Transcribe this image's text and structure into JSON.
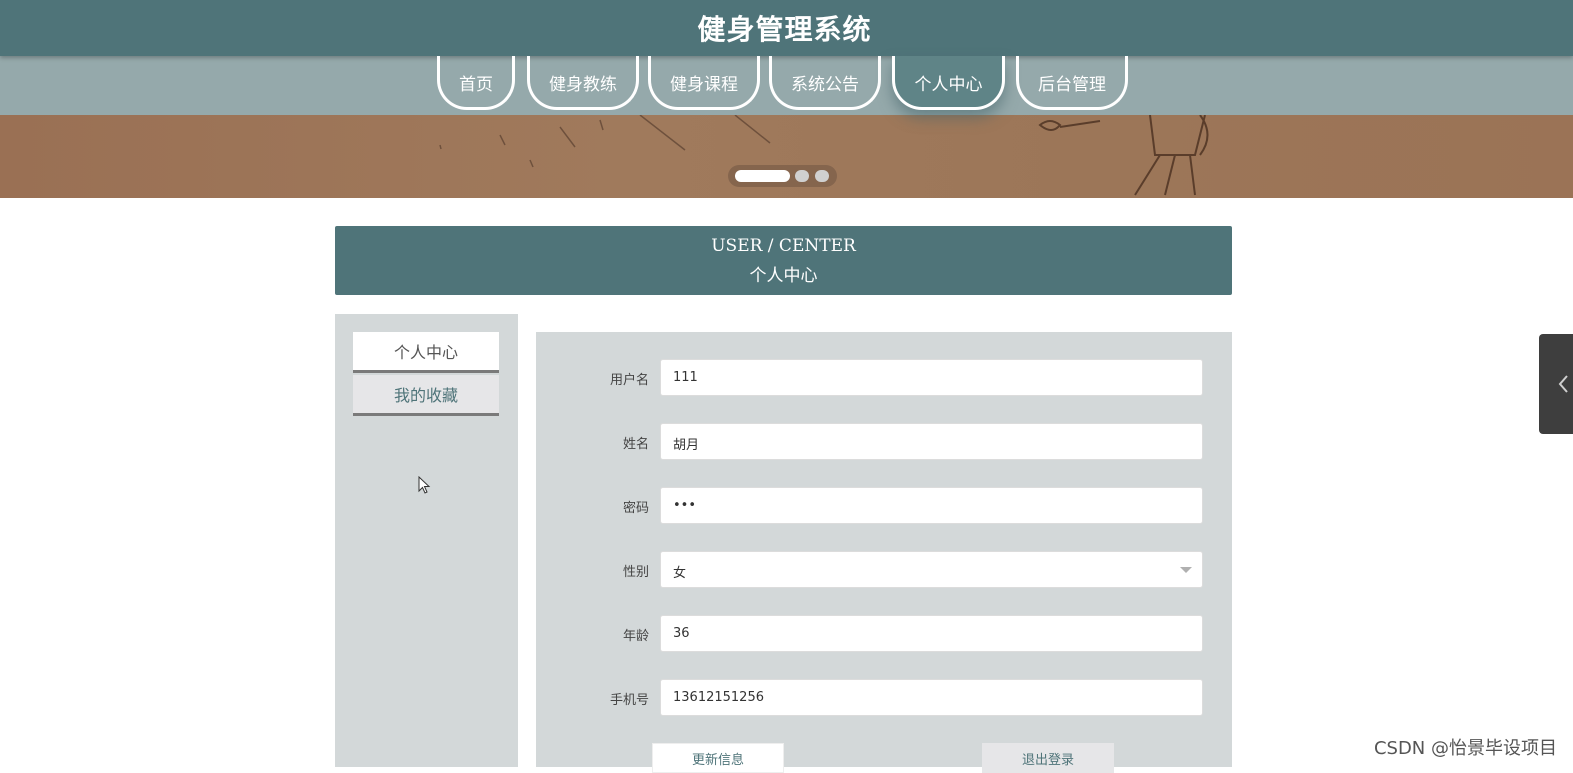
{
  "header": {
    "title": "健身管理系统"
  },
  "nav": {
    "items": [
      {
        "label": "首页",
        "active": false
      },
      {
        "label": "健身教练",
        "active": false
      },
      {
        "label": "健身课程",
        "active": false
      },
      {
        "label": "系统公告",
        "active": false
      },
      {
        "label": "个人中心",
        "active": true
      },
      {
        "label": "后台管理",
        "active": false
      }
    ]
  },
  "banner": {
    "slides": 3,
    "active_slide": 1
  },
  "user_center": {
    "title_en": "USER / CENTER",
    "title_cn": "个人中心"
  },
  "sidebar": {
    "items": [
      {
        "label": "个人中心"
      },
      {
        "label": "我的收藏"
      }
    ]
  },
  "form": {
    "fields": [
      {
        "label": "用户名",
        "value": "111"
      },
      {
        "label": "姓名",
        "value": "胡月"
      },
      {
        "label": "密码",
        "value": "•••"
      },
      {
        "label": "性别",
        "value": "女"
      },
      {
        "label": "年龄",
        "value": "36"
      },
      {
        "label": "手机号",
        "value": "13612151256"
      }
    ],
    "update_label": "更新信息",
    "logout_label": "退出登录"
  },
  "watermark": "CSDN @怡景毕设项目",
  "colors": {
    "primary": "#4f7479",
    "nav_bg": "#95a9ab",
    "panel_bg": "#d3d8d9"
  }
}
